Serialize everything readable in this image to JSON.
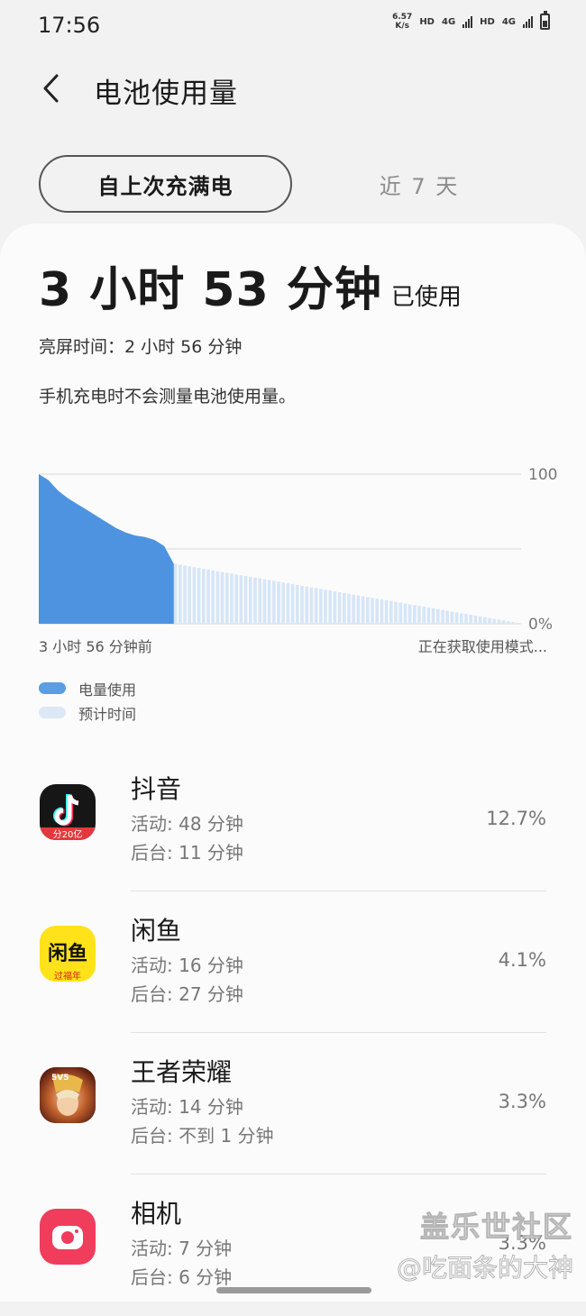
{
  "status_bar": {
    "time": "17:56",
    "net_speed_value": "6.57",
    "net_speed_unit": "K/s",
    "hd_1": "HD",
    "net_1": "4G",
    "hd_2": "HD",
    "net_2": "4G"
  },
  "header": {
    "title": "电池使用量"
  },
  "tabs": {
    "since_full_charge": "自上次充满电",
    "last_7_days": "近 7 天"
  },
  "summary": {
    "usage_time": "3 小时 53 分钟",
    "usage_suffix": "已使用",
    "screen_time": "亮屏时间：2 小时 56 分钟",
    "note": "手机充电时不会测量电池使用量。"
  },
  "chart_data": {
    "type": "area",
    "y_ticks": [
      "100",
      "0%"
    ],
    "ylim": [
      0,
      100
    ],
    "x_start_label": "3 小时 56 分钟前",
    "x_end_label": "正在获取使用模式...",
    "series": [
      {
        "name": "电量使用",
        "color": "#4d93e0",
        "x": [
          0,
          2,
          4,
          6,
          8,
          10,
          12,
          14,
          16,
          18,
          20,
          22,
          24,
          26,
          28
        ],
        "y": [
          100,
          96,
          89,
          84,
          80,
          76,
          72,
          68,
          64,
          61,
          59,
          58,
          56,
          52,
          40
        ]
      },
      {
        "name": "预计时间",
        "color": "#d6e6f8",
        "x": [
          28,
          100
        ],
        "y": [
          40,
          0
        ]
      }
    ],
    "grid": true
  },
  "legend": {
    "usage": "电量使用",
    "estimated": "预计时间"
  },
  "apps": [
    {
      "name": "抖音",
      "active": "活动: 48 分钟",
      "background": "后台: 11 分钟",
      "percent": "12.7%",
      "icon": "douyin-icon",
      "badge": "分20亿"
    },
    {
      "name": "闲鱼",
      "active": "活动: 16 分钟",
      "background": "后台: 27 分钟",
      "percent": "4.1%",
      "icon": "xianyu-icon",
      "logo": "闲鱼",
      "badge": "过福年"
    },
    {
      "name": "王者荣耀",
      "active": "活动: 14 分钟",
      "background": "后台: 不到 1 分钟",
      "percent": "3.3%",
      "icon": "honor-of-kings-icon",
      "badge": "5V5"
    },
    {
      "name": "相机",
      "active": "活动: 7 分钟",
      "background": "后台: 6 分钟",
      "percent": "3.3%",
      "icon": "camera-icon"
    }
  ],
  "watermark": {
    "line1": "盖乐世社区",
    "line2": "@吃面条的大神"
  }
}
